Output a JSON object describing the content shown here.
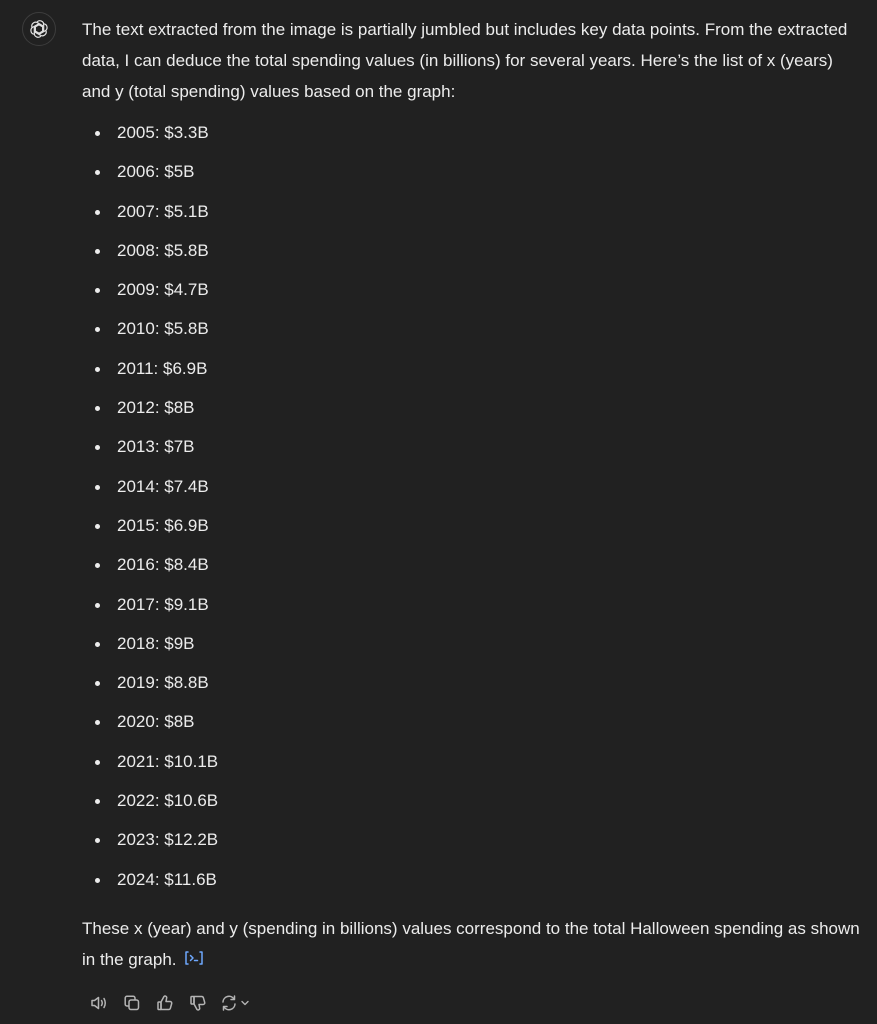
{
  "message": {
    "intro": "The text extracted from the image is partially jumbled but includes key data points. From the extracted data, I can deduce the total spending values (in billions) for several years. Here’s the list of x (years) and y (total spending) values based on the graph:",
    "points": [
      "2005: $3.3B",
      "2006: $5B",
      "2007: $5.1B",
      "2008: $5.8B",
      "2009: $4.7B",
      "2010: $5.8B",
      "2011: $6.9B",
      "2012: $8B",
      "2013: $7B",
      "2014: $7.4B",
      "2015: $6.9B",
      "2016: $8.4B",
      "2017: $9.1B",
      "2018: $9B",
      "2019: $8.8B",
      "2020: $8B",
      "2021: $10.1B",
      "2022: $10.6B",
      "2023: $12.2B",
      "2024: $11.6B"
    ],
    "closing": "These x (year) and y (spending in billions) values correspond to the total Halloween spending as shown in the graph."
  },
  "icons": {
    "avatar": "openai-logo-icon",
    "citation": "code-analysis-icon",
    "read_aloud": "speaker-icon",
    "copy": "copy-icon",
    "good": "thumbs-up-icon",
    "bad": "thumbs-down-icon",
    "regenerate": "refresh-icon",
    "menu": "chevron-down-icon"
  },
  "colors": {
    "background": "#212121",
    "text": "#ececec",
    "muted": "#b4b4b4",
    "link": "#6ea8fe"
  }
}
